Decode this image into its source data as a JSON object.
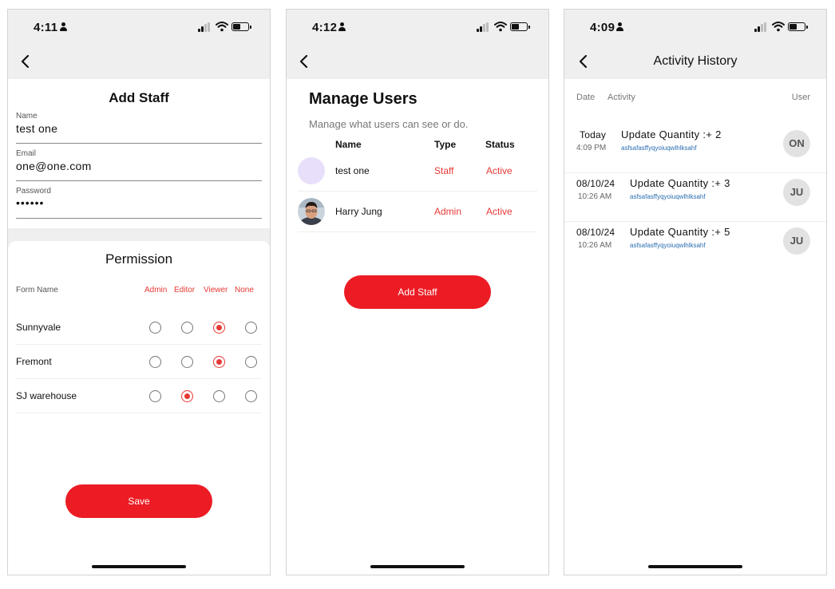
{
  "screens": [
    {
      "time": "4:11",
      "form": {
        "title": "Add Staff",
        "name_label": "Name",
        "name_value": "test one",
        "email_label": "Email",
        "email_value": "one@one.com",
        "password_label": "Password",
        "password_value": "••••••"
      },
      "permission": {
        "title": "Permission",
        "form_name_label": "Form Name",
        "columns": [
          "Admin",
          "Editor",
          "Viewer",
          "None"
        ],
        "rows": [
          {
            "name": "Sunnyvale",
            "selected": "Viewer"
          },
          {
            "name": "Fremont",
            "selected": "Viewer"
          },
          {
            "name": "SJ warehouse",
            "selected": "Editor"
          }
        ]
      },
      "save_label": "Save"
    },
    {
      "time": "4:12",
      "title": "Manage Users",
      "subtitle": "Manage what users can see or do.",
      "columns": {
        "name": "Name",
        "type": "Type",
        "status": "Status"
      },
      "users": [
        {
          "name": "test one",
          "type": "Staff",
          "status": "Active",
          "avatar": "empty-lavender"
        },
        {
          "name": "Harry Jung",
          "type": "Admin",
          "status": "Active",
          "avatar": "photo"
        }
      ],
      "add_staff_label": "Add Staff"
    },
    {
      "time": "4:09",
      "title": "Activity History",
      "columns": {
        "date": "Date",
        "activity": "Activity",
        "user": "User"
      },
      "items": [
        {
          "date": "Today",
          "time": "4:09 PM",
          "title": "Update Quantity :+ 2",
          "detail": "asfsafasffyqyoiuqwlhlksahf",
          "user": "ON"
        },
        {
          "date": "08/10/24",
          "time": "10:26 AM",
          "title": "Update Quantity :+ 3",
          "detail": "asfsafasffyqyoiuqwlhlksahf",
          "user": "JU"
        },
        {
          "date": "08/10/24",
          "time": "10:26 AM",
          "title": "Update Quantity :+ 5",
          "detail": "asfsafasffyqyoiuqwlhlksahf",
          "user": "JU"
        }
      ]
    }
  ],
  "colors": {
    "accent": "#ec1c24",
    "accent_text": "#e53935",
    "bar_background": "#efefef",
    "link_blue": "#2a6db0",
    "avatar_lavender": "#e8e0fb",
    "badge_gray": "#e2e2e2"
  },
  "icons": {
    "back": "chevron-left-icon",
    "status": [
      "person-icon",
      "signal-icon",
      "wifi-icon",
      "battery-icon"
    ]
  }
}
